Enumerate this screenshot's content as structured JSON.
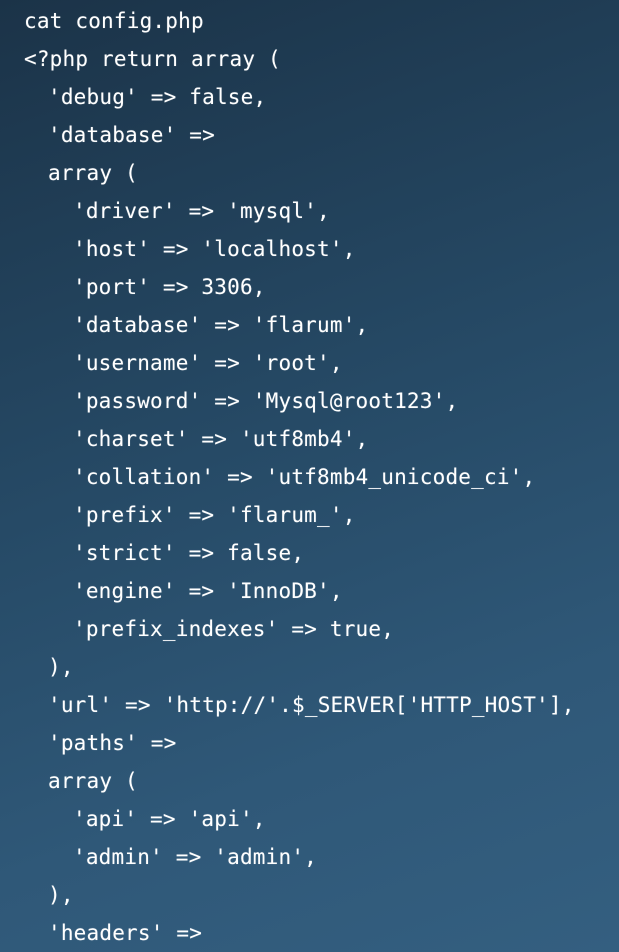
{
  "terminal": {
    "lines": [
      {
        "indent": 0,
        "text": "cat config.php"
      },
      {
        "indent": 0,
        "text": "<?php return array ("
      },
      {
        "indent": 1,
        "text": "'debug' => false,"
      },
      {
        "indent": 1,
        "text": "'database' =>"
      },
      {
        "indent": 1,
        "text": "array ("
      },
      {
        "indent": 2,
        "text": "'driver' => 'mysql',"
      },
      {
        "indent": 2,
        "text": "'host' => 'localhost',"
      },
      {
        "indent": 2,
        "text": "'port' => 3306,"
      },
      {
        "indent": 2,
        "text": "'database' => 'flarum',"
      },
      {
        "indent": 2,
        "text": "'username' => 'root',"
      },
      {
        "indent": 2,
        "text": "'password' => 'Mysql@root123',"
      },
      {
        "indent": 2,
        "text": "'charset' => 'utf8mb4',"
      },
      {
        "indent": 2,
        "text": "'collation' => 'utf8mb4_unicode_ci',"
      },
      {
        "indent": 2,
        "text": "'prefix' => 'flarum_',"
      },
      {
        "indent": 2,
        "text": "'strict' => false,"
      },
      {
        "indent": 2,
        "text": "'engine' => 'InnoDB',"
      },
      {
        "indent": 2,
        "text": "'prefix_indexes' => true,"
      },
      {
        "indent": 1,
        "text": "),"
      },
      {
        "indent": 1,
        "text": "'url' => 'http://'.$_SERVER['HTTP_HOST'],"
      },
      {
        "indent": 1,
        "text": "'paths' =>"
      },
      {
        "indent": 1,
        "text": "array ("
      },
      {
        "indent": 2,
        "text": "'api' => 'api',"
      },
      {
        "indent": 2,
        "text": "'admin' => 'admin',"
      },
      {
        "indent": 1,
        "text": "),"
      },
      {
        "indent": 1,
        "text": "'headers' =>"
      }
    ]
  }
}
